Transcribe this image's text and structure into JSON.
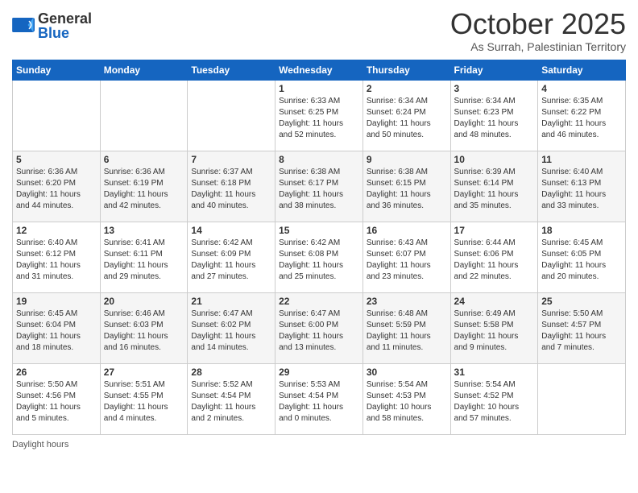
{
  "header": {
    "logo_general": "General",
    "logo_blue": "Blue",
    "month_title": "October 2025",
    "location": "As Surrah, Palestinian Territory"
  },
  "weekdays": [
    "Sunday",
    "Monday",
    "Tuesday",
    "Wednesday",
    "Thursday",
    "Friday",
    "Saturday"
  ],
  "weeks": [
    [
      {
        "day": "",
        "info": ""
      },
      {
        "day": "",
        "info": ""
      },
      {
        "day": "",
        "info": ""
      },
      {
        "day": "1",
        "info": "Sunrise: 6:33 AM\nSunset: 6:25 PM\nDaylight: 11 hours\nand 52 minutes."
      },
      {
        "day": "2",
        "info": "Sunrise: 6:34 AM\nSunset: 6:24 PM\nDaylight: 11 hours\nand 50 minutes."
      },
      {
        "day": "3",
        "info": "Sunrise: 6:34 AM\nSunset: 6:23 PM\nDaylight: 11 hours\nand 48 minutes."
      },
      {
        "day": "4",
        "info": "Sunrise: 6:35 AM\nSunset: 6:22 PM\nDaylight: 11 hours\nand 46 minutes."
      }
    ],
    [
      {
        "day": "5",
        "info": "Sunrise: 6:36 AM\nSunset: 6:20 PM\nDaylight: 11 hours\nand 44 minutes."
      },
      {
        "day": "6",
        "info": "Sunrise: 6:36 AM\nSunset: 6:19 PM\nDaylight: 11 hours\nand 42 minutes."
      },
      {
        "day": "7",
        "info": "Sunrise: 6:37 AM\nSunset: 6:18 PM\nDaylight: 11 hours\nand 40 minutes."
      },
      {
        "day": "8",
        "info": "Sunrise: 6:38 AM\nSunset: 6:17 PM\nDaylight: 11 hours\nand 38 minutes."
      },
      {
        "day": "9",
        "info": "Sunrise: 6:38 AM\nSunset: 6:15 PM\nDaylight: 11 hours\nand 36 minutes."
      },
      {
        "day": "10",
        "info": "Sunrise: 6:39 AM\nSunset: 6:14 PM\nDaylight: 11 hours\nand 35 minutes."
      },
      {
        "day": "11",
        "info": "Sunrise: 6:40 AM\nSunset: 6:13 PM\nDaylight: 11 hours\nand 33 minutes."
      }
    ],
    [
      {
        "day": "12",
        "info": "Sunrise: 6:40 AM\nSunset: 6:12 PM\nDaylight: 11 hours\nand 31 minutes."
      },
      {
        "day": "13",
        "info": "Sunrise: 6:41 AM\nSunset: 6:11 PM\nDaylight: 11 hours\nand 29 minutes."
      },
      {
        "day": "14",
        "info": "Sunrise: 6:42 AM\nSunset: 6:09 PM\nDaylight: 11 hours\nand 27 minutes."
      },
      {
        "day": "15",
        "info": "Sunrise: 6:42 AM\nSunset: 6:08 PM\nDaylight: 11 hours\nand 25 minutes."
      },
      {
        "day": "16",
        "info": "Sunrise: 6:43 AM\nSunset: 6:07 PM\nDaylight: 11 hours\nand 23 minutes."
      },
      {
        "day": "17",
        "info": "Sunrise: 6:44 AM\nSunset: 6:06 PM\nDaylight: 11 hours\nand 22 minutes."
      },
      {
        "day": "18",
        "info": "Sunrise: 6:45 AM\nSunset: 6:05 PM\nDaylight: 11 hours\nand 20 minutes."
      }
    ],
    [
      {
        "day": "19",
        "info": "Sunrise: 6:45 AM\nSunset: 6:04 PM\nDaylight: 11 hours\nand 18 minutes."
      },
      {
        "day": "20",
        "info": "Sunrise: 6:46 AM\nSunset: 6:03 PM\nDaylight: 11 hours\nand 16 minutes."
      },
      {
        "day": "21",
        "info": "Sunrise: 6:47 AM\nSunset: 6:02 PM\nDaylight: 11 hours\nand 14 minutes."
      },
      {
        "day": "22",
        "info": "Sunrise: 6:47 AM\nSunset: 6:00 PM\nDaylight: 11 hours\nand 13 minutes."
      },
      {
        "day": "23",
        "info": "Sunrise: 6:48 AM\nSunset: 5:59 PM\nDaylight: 11 hours\nand 11 minutes."
      },
      {
        "day": "24",
        "info": "Sunrise: 6:49 AM\nSunset: 5:58 PM\nDaylight: 11 hours\nand 9 minutes."
      },
      {
        "day": "25",
        "info": "Sunrise: 5:50 AM\nSunset: 4:57 PM\nDaylight: 11 hours\nand 7 minutes."
      }
    ],
    [
      {
        "day": "26",
        "info": "Sunrise: 5:50 AM\nSunset: 4:56 PM\nDaylight: 11 hours\nand 5 minutes."
      },
      {
        "day": "27",
        "info": "Sunrise: 5:51 AM\nSunset: 4:55 PM\nDaylight: 11 hours\nand 4 minutes."
      },
      {
        "day": "28",
        "info": "Sunrise: 5:52 AM\nSunset: 4:54 PM\nDaylight: 11 hours\nand 2 minutes."
      },
      {
        "day": "29",
        "info": "Sunrise: 5:53 AM\nSunset: 4:54 PM\nDaylight: 11 hours\nand 0 minutes."
      },
      {
        "day": "30",
        "info": "Sunrise: 5:54 AM\nSunset: 4:53 PM\nDaylight: 10 hours\nand 58 minutes."
      },
      {
        "day": "31",
        "info": "Sunrise: 5:54 AM\nSunset: 4:52 PM\nDaylight: 10 hours\nand 57 minutes."
      },
      {
        "day": "",
        "info": ""
      }
    ]
  ],
  "footer": {
    "daylight_label": "Daylight hours"
  }
}
